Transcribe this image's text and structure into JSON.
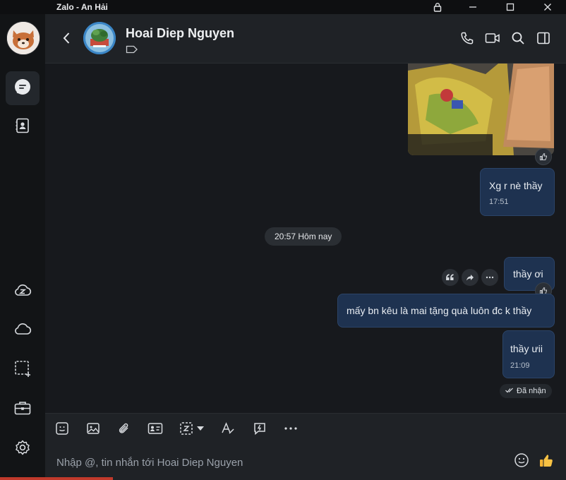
{
  "window": {
    "title": "Zalo - An Hải"
  },
  "header": {
    "contact_name": "Hoai Diep Nguyen"
  },
  "messages": [
    {
      "text": "Xg r nè thầy",
      "time": "17:51"
    },
    {
      "text": "thầy ơi"
    },
    {
      "text": "mấy bn kêu là mai tặng quà luôn đc k thầy"
    },
    {
      "text": "thầy ưii",
      "time": "21:09"
    }
  ],
  "date_divider": "20:57 Hôm nay",
  "status": "Đã nhận",
  "composer": {
    "placeholder": "Nhập @, tin nhắn tới Hoai Diep Nguyen"
  },
  "colors": {
    "bubble": "#1e3250",
    "background": "#17191d",
    "sidebar": "#121416",
    "header": "#1f2226"
  }
}
